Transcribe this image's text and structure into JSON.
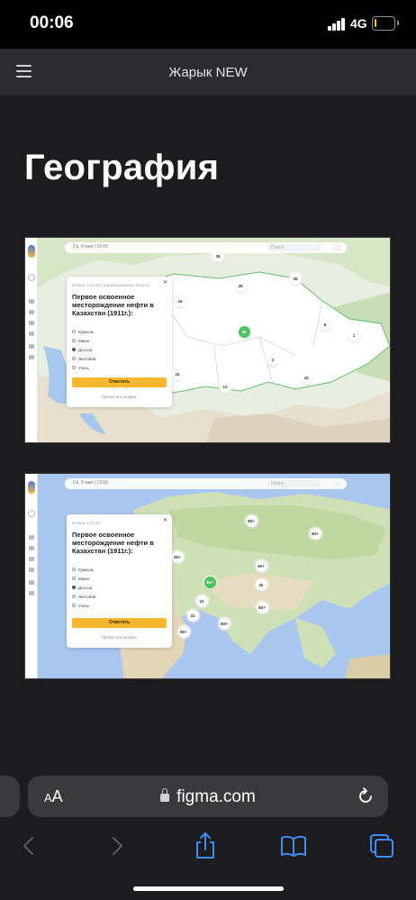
{
  "status_bar": {
    "time": "00:06",
    "network": "4G",
    "battery_level": 0.12,
    "battery_color": "#ffcc00",
    "signal_bars": 4
  },
  "header": {
    "title": "Жарык NEW",
    "menu_icon": "hamburger-menu-icon"
  },
  "page": {
    "title": "География"
  },
  "frames": [
    {
      "topbar_date": "Ср, 8 мая | 19:00",
      "search_placeholder": "Поиск",
      "quiz": {
        "meta": "Вопрос 1 из 10  |  Карагандинская область",
        "question": "Первое освоенное месторождение нефти в Казахстан (1911г.):",
        "options": [
          "Кумколь",
          "Макат",
          "Доссор",
          "Жетыбай",
          "Узень"
        ],
        "selected_index": 2,
        "answer_label": "Ответить",
        "skip_label": "Пропустить вопрос"
      },
      "clusters": [
        "26",
        "26",
        "26",
        "38",
        "8",
        "1",
        "30",
        "2",
        "24",
        "13",
        "15"
      ]
    },
    {
      "topbar_date": "Ср, 8 мая | 19:00",
      "search_placeholder": "Поиск",
      "quiz": {
        "meta": "Вопрос 1 из 10",
        "question": "Первое освоенное месторождение нефти в Казахстан (1911г.):",
        "options": [
          "Кумколь",
          "Макат",
          "Доссор",
          "Жетыбай",
          "Узень"
        ],
        "selected_index": 2,
        "answer_label": "Ответить",
        "skip_label": "Пропустить вопрос"
      },
      "clusters": [
        "80+",
        "80+",
        "80+",
        "90+",
        "80+",
        "2k",
        "80+",
        "10",
        "80+",
        "15",
        "80+"
      ]
    }
  ],
  "browser": {
    "text_size_label_small": "A",
    "text_size_label_large": "A",
    "url": "figma.com",
    "colors": {
      "accent": "#f7b731",
      "cluster_active": "#4cc35f",
      "background": "#1c1c1e"
    }
  }
}
